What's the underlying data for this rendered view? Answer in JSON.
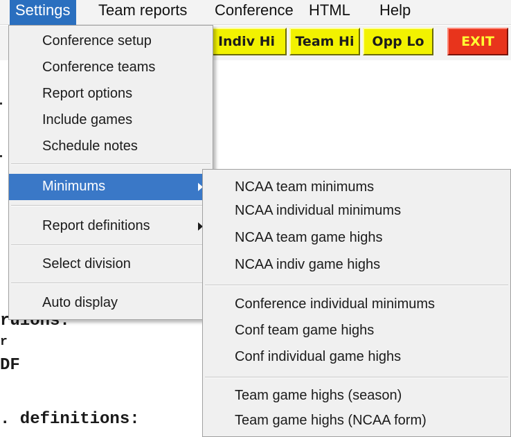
{
  "menubar": {
    "items": [
      "Settings",
      "Team reports",
      "Conference",
      "HTML",
      "Help"
    ]
  },
  "toolbar": {
    "buttons": [
      "Indiv Hi",
      "Team Hi",
      "Opp Lo",
      "EXIT"
    ]
  },
  "document": {
    "lines": [
      "ruions:",
      "r",
      "DF",
      ". definitions:"
    ]
  },
  "settings_menu": {
    "items": [
      "Conference setup",
      "Conference teams",
      "Report options",
      "Include games",
      "Schedule notes",
      "Minimums",
      "Report definitions",
      "Select division",
      "Auto display"
    ]
  },
  "minimums_submenu": {
    "items": [
      "NCAA team minimums",
      "NCAA individual minimums",
      "NCAA team game highs",
      "NCAA indiv game highs",
      "Conference individual minimums",
      "Conf team game highs",
      "Conf individual game highs",
      "Team game highs (season)",
      "Team game highs (NCAA form)"
    ]
  },
  "colors": {
    "menu_highlight": "#3a78c7",
    "toolbar_button": "#f2f200",
    "exit_button": "#e8341c"
  }
}
